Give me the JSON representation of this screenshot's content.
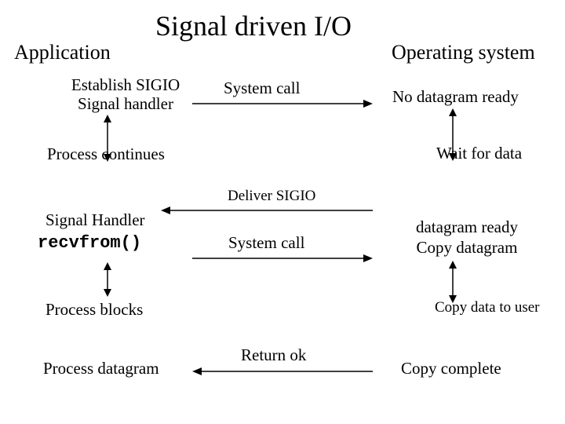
{
  "title": "Signal driven I/O",
  "left_header": "Application",
  "right_header": "Operating system",
  "establish_l1": "Establish SIGIO",
  "establish_l2": "Signal handler",
  "syscall1": "System call",
  "no_datagram": "No datagram ready",
  "process_continues": "Process continues",
  "wait_for_data": "Wait for data",
  "deliver_sigio": "Deliver SIGIO",
  "signal_handler": "Signal Handler",
  "recvfrom": "recvfrom()",
  "syscall2": "System call",
  "datagram_ready": "datagram ready",
  "copy_datagram": "Copy datagram",
  "process_blocks": "Process blocks",
  "copy_to_user": "Copy data to user",
  "return_ok": "Return ok",
  "process_datagram": "Process datagram",
  "copy_complete": "Copy complete"
}
